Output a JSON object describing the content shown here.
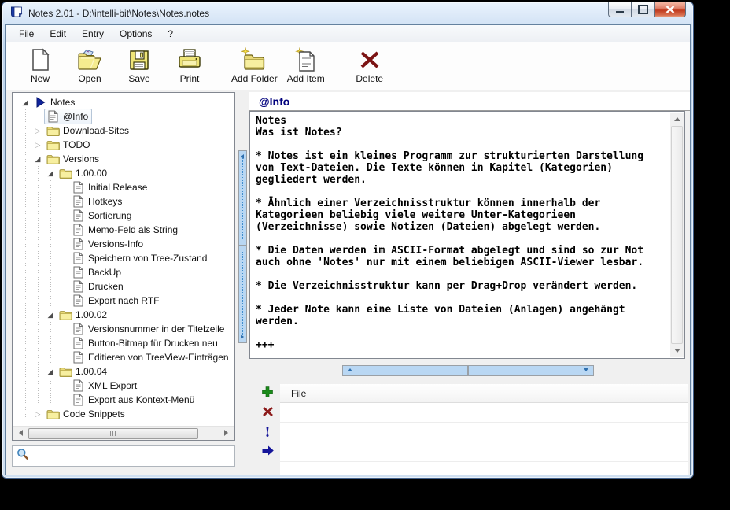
{
  "titlebar": {
    "title": "Notes 2.01 - D:\\intelli-bit\\Notes\\Notes.notes",
    "icon": "notes-app-icon"
  },
  "menubar": {
    "items": [
      "File",
      "Edit",
      "Entry",
      "Options",
      "?"
    ]
  },
  "toolbar": {
    "buttons": [
      {
        "label": "New",
        "icon": "new-document-icon"
      },
      {
        "label": "Open",
        "icon": "open-folder-icon"
      },
      {
        "label": "Save",
        "icon": "save-floppy-icon"
      },
      {
        "label": "Print",
        "icon": "print-icon"
      },
      {
        "label": "Add Folder",
        "icon": "add-folder-icon"
      },
      {
        "label": "Add Item",
        "icon": "add-item-icon"
      },
      {
        "label": "Delete",
        "icon": "delete-x-icon"
      }
    ]
  },
  "tree": {
    "items": [
      {
        "label": "Notes",
        "depth": 0,
        "icon": "notes-root-icon",
        "expander": "expanded",
        "selected": false
      },
      {
        "label": "@Info",
        "depth": 1,
        "icon": "note-page-icon",
        "expander": "none",
        "selected": true
      },
      {
        "label": "Download-Sites",
        "depth": 1,
        "icon": "folder-icon",
        "expander": "collapsed",
        "selected": false
      },
      {
        "label": "TODO",
        "depth": 1,
        "icon": "folder-icon",
        "expander": "collapsed",
        "selected": false
      },
      {
        "label": "Versions",
        "depth": 1,
        "icon": "folder-icon",
        "expander": "expanded",
        "selected": false
      },
      {
        "label": "1.00.00",
        "depth": 2,
        "icon": "folder-icon",
        "expander": "expanded",
        "selected": false
      },
      {
        "label": "Initial Release",
        "depth": 3,
        "icon": "note-page-icon",
        "expander": "none",
        "selected": false
      },
      {
        "label": "Hotkeys",
        "depth": 3,
        "icon": "note-page-icon",
        "expander": "none",
        "selected": false
      },
      {
        "label": "Sortierung",
        "depth": 3,
        "icon": "note-page-icon",
        "expander": "none",
        "selected": false
      },
      {
        "label": "Memo-Feld als String",
        "depth": 3,
        "icon": "note-page-icon",
        "expander": "none",
        "selected": false
      },
      {
        "label": "Versions-Info",
        "depth": 3,
        "icon": "note-page-icon",
        "expander": "none",
        "selected": false
      },
      {
        "label": "Speichern von Tree-Zustand",
        "depth": 3,
        "icon": "note-page-icon",
        "expander": "none",
        "selected": false
      },
      {
        "label": "BackUp",
        "depth": 3,
        "icon": "note-page-icon",
        "expander": "none",
        "selected": false
      },
      {
        "label": "Drucken",
        "depth": 3,
        "icon": "note-page-icon",
        "expander": "none",
        "selected": false
      },
      {
        "label": "Export nach RTF",
        "depth": 3,
        "icon": "note-page-icon",
        "expander": "none",
        "selected": false
      },
      {
        "label": "1.00.02",
        "depth": 2,
        "icon": "folder-icon",
        "expander": "expanded",
        "selected": false
      },
      {
        "label": "Versionsnummer in der Titelzeile",
        "depth": 3,
        "icon": "note-page-icon",
        "expander": "none",
        "selected": false
      },
      {
        "label": "Button-Bitmap für Drucken neu",
        "depth": 3,
        "icon": "note-page-icon",
        "expander": "none",
        "selected": false
      },
      {
        "label": "Editieren von TreeView-Einträgen",
        "depth": 3,
        "icon": "note-page-icon",
        "expander": "none",
        "selected": false
      },
      {
        "label": "1.00.04",
        "depth": 2,
        "icon": "folder-icon",
        "expander": "expanded",
        "selected": false
      },
      {
        "label": "XML Export",
        "depth": 3,
        "icon": "note-page-icon",
        "expander": "none",
        "selected": false
      },
      {
        "label": "Export aus Kontext-Menü",
        "depth": 3,
        "icon": "note-page-icon",
        "expander": "none",
        "selected": false
      },
      {
        "label": "Code Snippets",
        "depth": 1,
        "icon": "folder-icon",
        "expander": "collapsed",
        "selected": false
      }
    ]
  },
  "search": {
    "value": "",
    "icon": "magnifier-icon"
  },
  "note": {
    "title": "@Info",
    "body": "Notes\nWas ist Notes?\n\n* Notes ist ein kleines Programm zur strukturierten Darstellung\nvon Text-Dateien. Die Texte können in Kapitel (Kategorien)\ngegliedert werden.\n\n* Ähnlich einer Verzeichnisstruktur können innerhalb der\nKategorieen beliebig viele weitere Unter-Kategorieen\n(Verzeichnisse) sowie Notizen (Dateien) abgelegt werden.\n\n* Die Daten werden im ASCII-Format abgelegt und sind so zur Not\nauch ohne 'Notes' nur mit einem beliebigen ASCII-Viewer lesbar.\n\n* Die Verzeichnisstruktur kann per Drag+Drop verändert werden.\n\n* Jeder Note kann eine Liste von Dateien (Anlagen) angehängt\nwerden.\n\n+++"
  },
  "attachments": {
    "columns": [
      "File"
    ],
    "rows": [],
    "buttons": [
      {
        "name": "add-file-button",
        "icon": "plus-icon",
        "color": "#1a8a1a"
      },
      {
        "name": "remove-file-button",
        "icon": "cross-icon",
        "color": "#8c1a1a"
      },
      {
        "name": "exclaim-file-button",
        "icon": "exclamation-icon",
        "color": "#15159a",
        "glyph": "!"
      },
      {
        "name": "open-file-button",
        "icon": "arrow-right-icon",
        "color": "#15159a"
      }
    ]
  },
  "colors": {
    "title_navy": "#00007d",
    "folder_yellow": "#f3e98c",
    "delete_red": "#7c1414",
    "add_green": "#1a8a1a",
    "splitter_blue": "#b9d7f3"
  }
}
